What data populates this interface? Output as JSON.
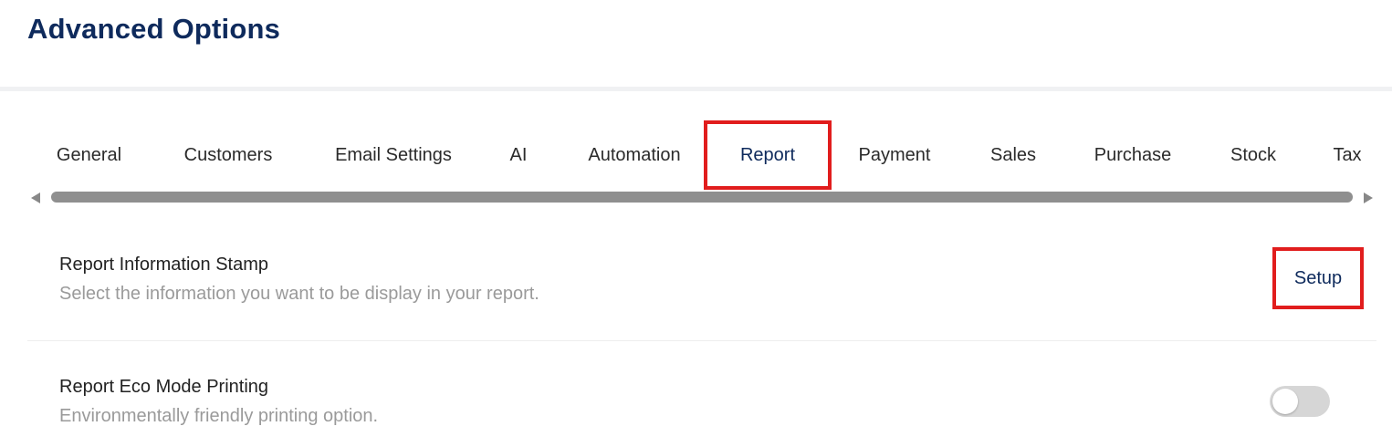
{
  "header": {
    "title": "Advanced Options"
  },
  "tabs": [
    {
      "label": "General"
    },
    {
      "label": "Customers"
    },
    {
      "label": "Email Settings"
    },
    {
      "label": "AI"
    },
    {
      "label": "Automation"
    },
    {
      "label": "Report",
      "active": true
    },
    {
      "label": "Payment"
    },
    {
      "label": "Sales"
    },
    {
      "label": "Purchase"
    },
    {
      "label": "Stock"
    },
    {
      "label": "Tax"
    }
  ],
  "settings": {
    "report_stamp": {
      "title": "Report Information Stamp",
      "description": "Select the information you want to be display in your report.",
      "button_label": "Setup"
    },
    "eco_mode": {
      "title": "Report Eco Mode Printing",
      "description": "Environmentally friendly printing option.",
      "enabled": false
    }
  },
  "colors": {
    "title": "#0e2a5c",
    "highlight": "#e11d1d",
    "toggle_off": "#d6d6d6"
  }
}
